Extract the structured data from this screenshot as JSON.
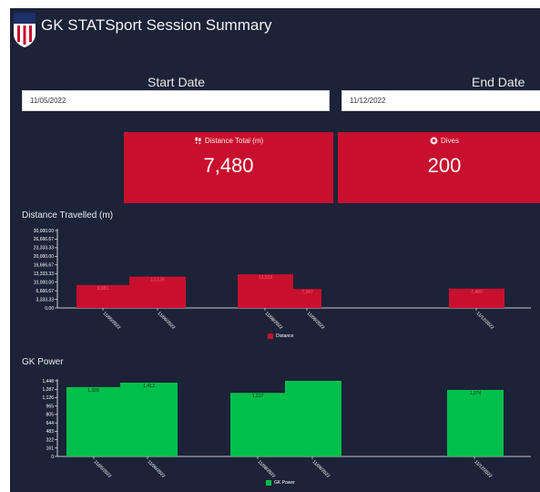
{
  "header": {
    "title": "GK STATSport Session Summary",
    "crest_text": "USA"
  },
  "filters": {
    "start_label": "Start Date",
    "start_value": "11/05/2022",
    "end_label": "End Date",
    "end_value": "11/12/2022"
  },
  "kpis": [
    {
      "label": "Distance Total (m)",
      "value": "7,480",
      "icon": "footsteps-icon"
    },
    {
      "label": "Dives",
      "value": "200",
      "icon": "ball-icon"
    }
  ],
  "colors": {
    "background": "#1c2237",
    "accent_red": "#c8102e",
    "accent_green": "#00c04b"
  },
  "charts": {
    "distance": {
      "title": "Distance Travelled (m)",
      "legend": "Distance"
    },
    "power": {
      "title": "GK Power",
      "legend": "GK Power"
    }
  },
  "chart_data": [
    {
      "type": "bar",
      "title": "Distance Travelled (m)",
      "categories": [
        "11/05/2022",
        "11/06/2022",
        "11/08/2022",
        "11/09/2022",
        "11/12/2022"
      ],
      "values": [
        8881,
        12136,
        13013,
        7347,
        7480
      ],
      "data_labels": [
        "8,881",
        "12,136",
        "13,013",
        "7,347",
        "7,480"
      ],
      "y_ticks": [
        "0.00",
        "3,333.33",
        "6,666.67",
        "10,000.00",
        "13,333.33",
        "16,666.67",
        "20,000.00",
        "23,333.33",
        "26,666.67",
        "30,000.00"
      ],
      "ylim": [
        0,
        30000
      ],
      "series": [
        {
          "name": "Distance",
          "values": [
            8881,
            12136,
            13013,
            7347,
            7480
          ]
        }
      ],
      "color": "#c8102e",
      "legend_position": "bottom-center",
      "grid": false
    },
    {
      "type": "bar",
      "title": "GK Power",
      "categories": [
        "11/05/2022",
        "11/06/2022",
        "11/08/2022",
        "11/09/2022",
        "11/12/2022"
      ],
      "values": [
        1328,
        1413,
        1217,
        1448,
        1274
      ],
      "data_labels": [
        "1,328",
        "1,413",
        "1,217",
        "",
        "1,274"
      ],
      "y_ticks": [
        "0",
        "161",
        "322",
        "483",
        "644",
        "805",
        "965",
        "1,126",
        "1,287",
        "1,448"
      ],
      "ylim": [
        0,
        1448
      ],
      "series": [
        {
          "name": "GK Power",
          "values": [
            1328,
            1413,
            1217,
            1448,
            1274
          ]
        }
      ],
      "color": "#00c04b",
      "legend_position": "bottom-center",
      "grid": false
    }
  ]
}
